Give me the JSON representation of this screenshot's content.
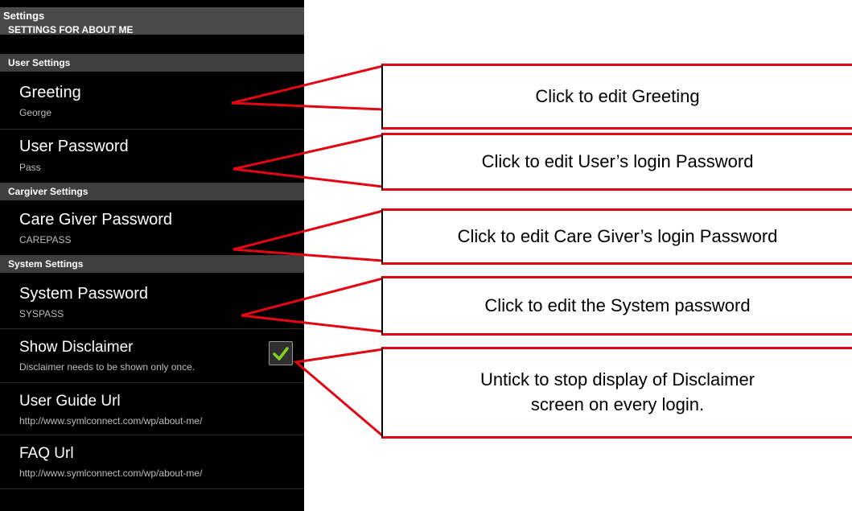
{
  "app": {
    "title": "Settings",
    "subtitle": "SETTINGS FOR ABOUT ME"
  },
  "categories": {
    "user": "User Settings",
    "caregiver": "Cargiver Settings",
    "system": "System Settings"
  },
  "prefs": {
    "greeting": {
      "title": "Greeting",
      "summary": "George"
    },
    "user_password": {
      "title": "User Password",
      "summary": "Pass"
    },
    "caregiver_password": {
      "title": "Care Giver Password",
      "summary": "CAREPASS"
    },
    "system_password": {
      "title": "System  Password",
      "summary": "SYSPASS"
    },
    "show_disclaimer": {
      "title": "Show Disclaimer",
      "summary": "Disclaimer needs to be shown only once.",
      "checked": true
    },
    "user_guide_url": {
      "title": "User Guide Url",
      "summary": "http://www.symlconnect.com/wp/about-me/"
    },
    "faq_url": {
      "title": "FAQ Url",
      "summary": "http://www.symlconnect.com/wp/about-me/"
    }
  },
  "callouts": {
    "greeting": "Click to edit Greeting",
    "user_password": "Click to edit User’s login Password",
    "caregiver_password": "Click to edit Care Giver’s login Password",
    "system_password": "Click to edit the System password",
    "disclaimer_line1": "Untick to stop display of Disclaimer",
    "disclaimer_line2": "screen on every login."
  },
  "colors": {
    "callout_border": "#e30613",
    "checkmark": "#7ed321",
    "screen_background": "#000000",
    "category_background": "#3f3f3f"
  }
}
